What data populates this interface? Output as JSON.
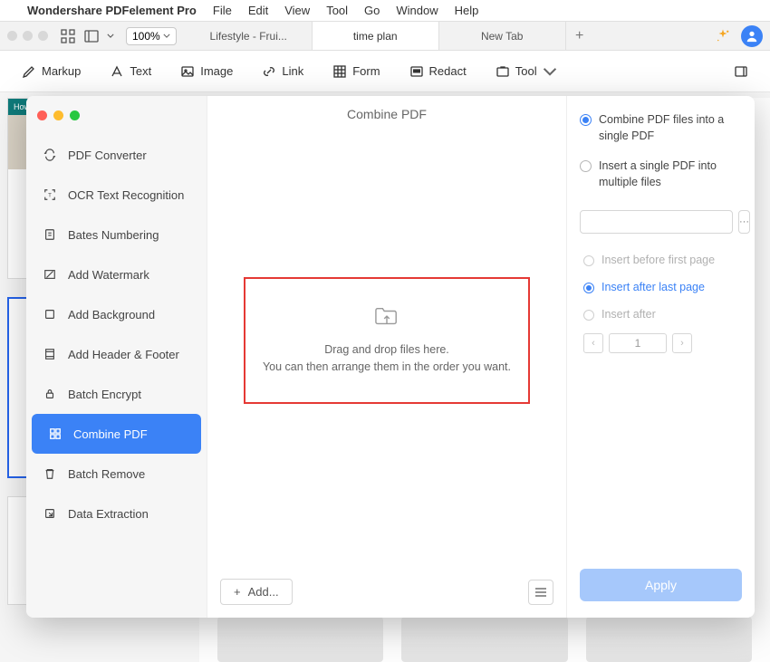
{
  "menubar": {
    "app_name": "Wondershare PDFelement Pro",
    "items": [
      "File",
      "Edit",
      "View",
      "Tool",
      "Go",
      "Window",
      "Help"
    ]
  },
  "topbar": {
    "zoom": "100%",
    "tabs": [
      {
        "label": "Lifestyle - Frui...",
        "active": false
      },
      {
        "label": "time plan",
        "active": true
      },
      {
        "label": "New Tab",
        "active": false
      }
    ]
  },
  "ribbon": [
    {
      "icon": "markup-icon",
      "label": "Markup"
    },
    {
      "icon": "text-icon",
      "label": "Text"
    },
    {
      "icon": "image-icon",
      "label": "Image"
    },
    {
      "icon": "link-icon",
      "label": "Link"
    },
    {
      "icon": "form-icon",
      "label": "Form"
    },
    {
      "icon": "redact-icon",
      "label": "Redact"
    },
    {
      "icon": "tool-icon",
      "label": "Tool"
    }
  ],
  "bg_thumb_title": "How to Plan your Time Effectively",
  "modal": {
    "title": "Combine PDF",
    "nav": [
      {
        "icon": "converter-icon",
        "label": "PDF Converter"
      },
      {
        "icon": "ocr-icon",
        "label": "OCR Text Recognition"
      },
      {
        "icon": "bates-icon",
        "label": "Bates Numbering"
      },
      {
        "icon": "watermark-icon",
        "label": "Add Watermark"
      },
      {
        "icon": "background-icon",
        "label": "Add Background"
      },
      {
        "icon": "headerfooter-icon",
        "label": "Add Header & Footer"
      },
      {
        "icon": "encrypt-icon",
        "label": "Batch Encrypt"
      },
      {
        "icon": "combine-icon",
        "label": "Combine PDF",
        "selected": true
      },
      {
        "icon": "remove-icon",
        "label": "Batch Remove"
      },
      {
        "icon": "extract-icon",
        "label": "Data Extraction"
      }
    ],
    "dropzone_line1": "Drag and drop files here.",
    "dropzone_line2": "You can then arrange them in the order you want.",
    "add_button": "Add...",
    "right": {
      "option1": "Combine PDF files into a single PDF",
      "option2": "Insert a single PDF into multiple files",
      "sub_before": "Insert before first page",
      "sub_after_last": "Insert after last page",
      "sub_after": "Insert after",
      "page_value": "1",
      "apply": "Apply"
    }
  }
}
